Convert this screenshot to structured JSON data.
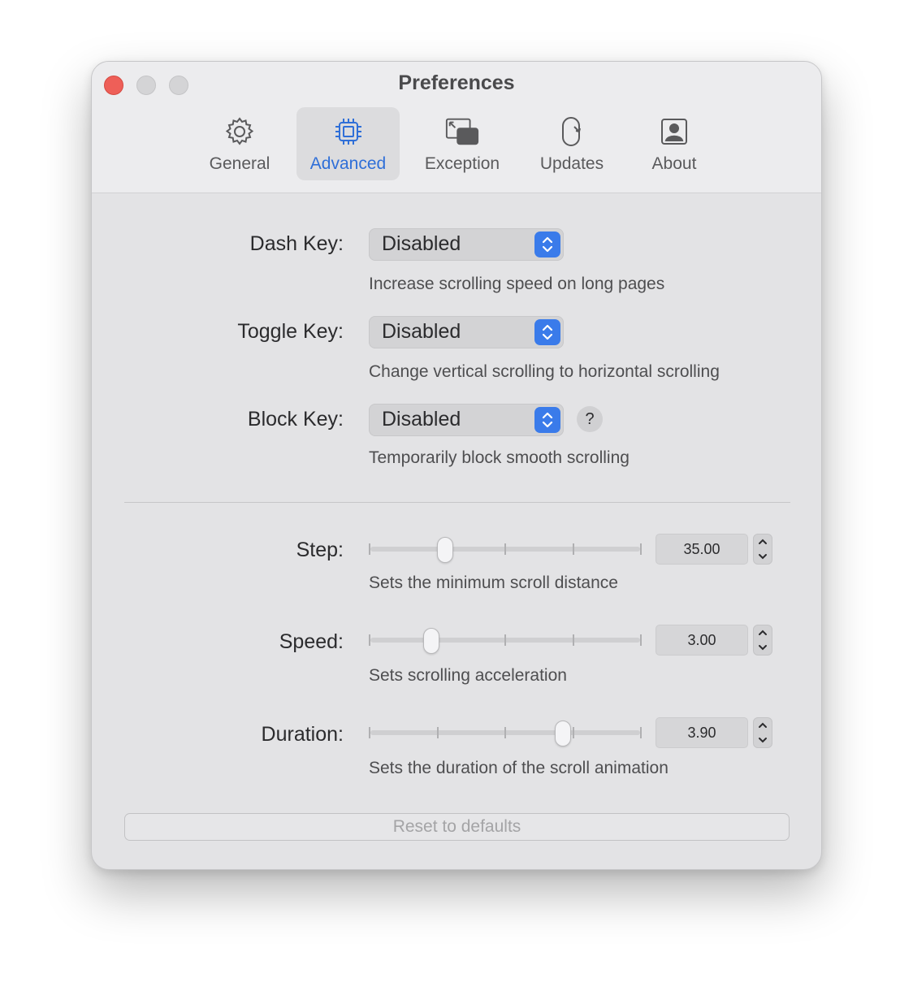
{
  "window": {
    "title": "Preferences",
    "colors": {
      "accent": "#2f6fd8",
      "close": "#ee5f58"
    }
  },
  "tabs": [
    {
      "label": "General",
      "icon": "gear-icon",
      "active": false
    },
    {
      "label": "Advanced",
      "icon": "chip-icon",
      "active": true
    },
    {
      "label": "Exception",
      "icon": "windows-icon",
      "active": false
    },
    {
      "label": "Updates",
      "icon": "refresh-icon",
      "active": false
    },
    {
      "label": "About",
      "icon": "person-icon",
      "active": false
    }
  ],
  "keys": {
    "dash": {
      "label": "Dash Key:",
      "value": "Disabled",
      "description": "Increase scrolling speed on long pages"
    },
    "toggle": {
      "label": "Toggle Key:",
      "value": "Disabled",
      "description": "Change vertical scrolling to horizontal scrolling"
    },
    "block": {
      "label": "Block Key:",
      "value": "Disabled",
      "description": "Temporarily block smooth scrolling",
      "help": "?"
    }
  },
  "sliders": {
    "step": {
      "label": "Step:",
      "value": "35.00",
      "position": 0.28,
      "description": "Sets the minimum scroll distance"
    },
    "speed": {
      "label": "Speed:",
      "value": "3.00",
      "position": 0.23,
      "description": "Sets scrolling acceleration"
    },
    "duration": {
      "label": "Duration:",
      "value": "3.90",
      "position": 0.71,
      "description": "Sets the duration of the scroll animation"
    }
  },
  "reset_label": "Reset to defaults"
}
